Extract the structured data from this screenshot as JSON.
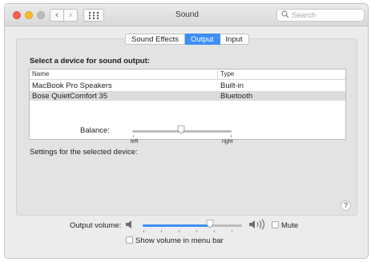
{
  "window": {
    "title": "Sound",
    "search_placeholder": "Search",
    "nav": {
      "back_glyph": "‹",
      "forward_glyph": "›",
      "grid_glyph": "⋮⋮⋮"
    }
  },
  "tabs": [
    {
      "label": "Sound Effects",
      "active": false
    },
    {
      "label": "Output",
      "active": true
    },
    {
      "label": "Input",
      "active": false
    }
  ],
  "output": {
    "section_title": "Select a device for sound output:",
    "columns": [
      "Name",
      "Type"
    ],
    "devices": [
      {
        "name": "MacBook Pro Speakers",
        "type": "Built-in",
        "selected": false
      },
      {
        "name": "Bose QuietComfort 35",
        "type": "Bluetooth",
        "selected": true
      }
    ],
    "settings_label": "Settings for the selected device:",
    "balance": {
      "label": "Balance:",
      "left_label": "left",
      "right_label": "right",
      "value": 0.5
    }
  },
  "footer": {
    "output_volume_label": "Output volume:",
    "volume": 0.68,
    "mute_label": "Mute",
    "mute_checked": false,
    "show_in_menu_bar_label": "Show volume in menu bar",
    "show_in_menu_bar_checked": false
  },
  "help_glyph": "?",
  "icons": {
    "search": "search-icon",
    "speaker_low": "speaker-low-icon",
    "speaker_high": "speaker-high-icon"
  },
  "colors": {
    "accent": "#3d8ef7",
    "close": "#fe5f57",
    "minimize": "#febc2e"
  }
}
